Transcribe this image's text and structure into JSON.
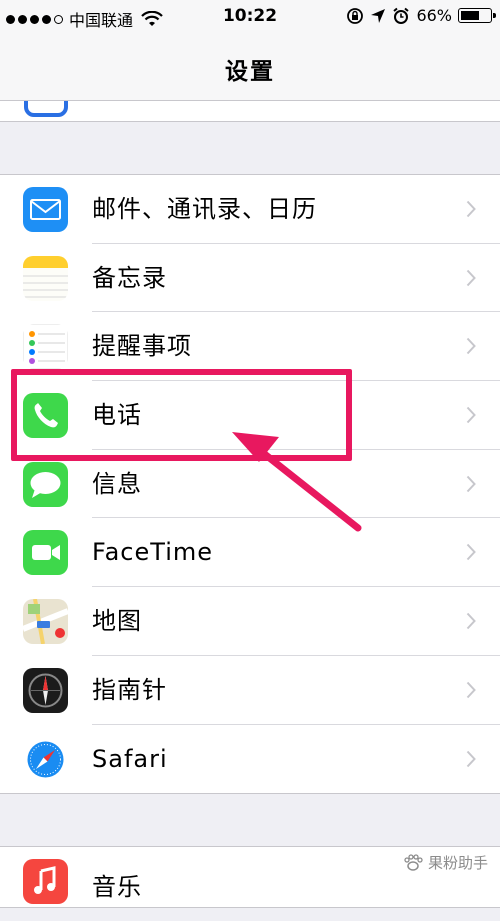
{
  "status_bar": {
    "carrier": "中国联通",
    "time": "10:22",
    "battery": "66%",
    "battery_level": 0.66
  },
  "nav": {
    "title": "设置"
  },
  "settings": [
    {
      "label": "邮件、通讯录、日历",
      "icon": "mail-icon",
      "color": "#1e8ff5"
    },
    {
      "label": "备忘录",
      "icon": "notes-icon",
      "color": "#ffcf2e"
    },
    {
      "label": "提醒事项",
      "icon": "reminders-icon",
      "color": "#ffffff"
    },
    {
      "label": "电话",
      "icon": "phone-icon",
      "color": "#3ed84b"
    },
    {
      "label": "信息",
      "icon": "messages-icon",
      "color": "#3ed84b"
    },
    {
      "label": "FaceTime",
      "icon": "facetime-icon",
      "color": "#3ed84b"
    },
    {
      "label": "地图",
      "icon": "maps-icon",
      "color": "#e9e3d0"
    },
    {
      "label": "指南针",
      "icon": "compass-icon",
      "color": "#1b1b1b"
    },
    {
      "label": "Safari",
      "icon": "safari-icon",
      "color": "#ffffff"
    }
  ],
  "settings_group2": [
    {
      "label": "音乐",
      "icon": "music-icon",
      "color": "#f5463f"
    }
  ],
  "annotation": {
    "color": "#e8185f"
  },
  "watermark": {
    "text": "果粉助手"
  }
}
